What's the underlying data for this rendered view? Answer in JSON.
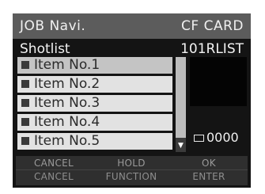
{
  "titlebar": {
    "left": "JOB Navi.",
    "right": "CF CARD"
  },
  "subheader": {
    "left": "Shotlist",
    "right": "101RLIST"
  },
  "list": {
    "items": [
      {
        "label": "Item No.1",
        "selected": true
      },
      {
        "label": "Item No.2",
        "selected": false
      },
      {
        "label": "Item No.3",
        "selected": false
      },
      {
        "label": "Item No.4",
        "selected": false
      },
      {
        "label": "Item No.5",
        "selected": false
      }
    ],
    "scroll_down_glyph": "▼"
  },
  "counter": {
    "value": "0000"
  },
  "softkeys": [
    {
      "primary": "CANCEL",
      "secondary": "CANCEL"
    },
    {
      "primary": "HOLD",
      "secondary": "FUNCTION"
    },
    {
      "primary": "OK",
      "secondary": "ENTER"
    }
  ],
  "colors": {
    "background": "#141414",
    "titlebar": "#5c5c5c",
    "list_item": "#e2e2e2",
    "list_item_selected": "#c4c4c4",
    "softkey_text": "#9a9a9a"
  }
}
